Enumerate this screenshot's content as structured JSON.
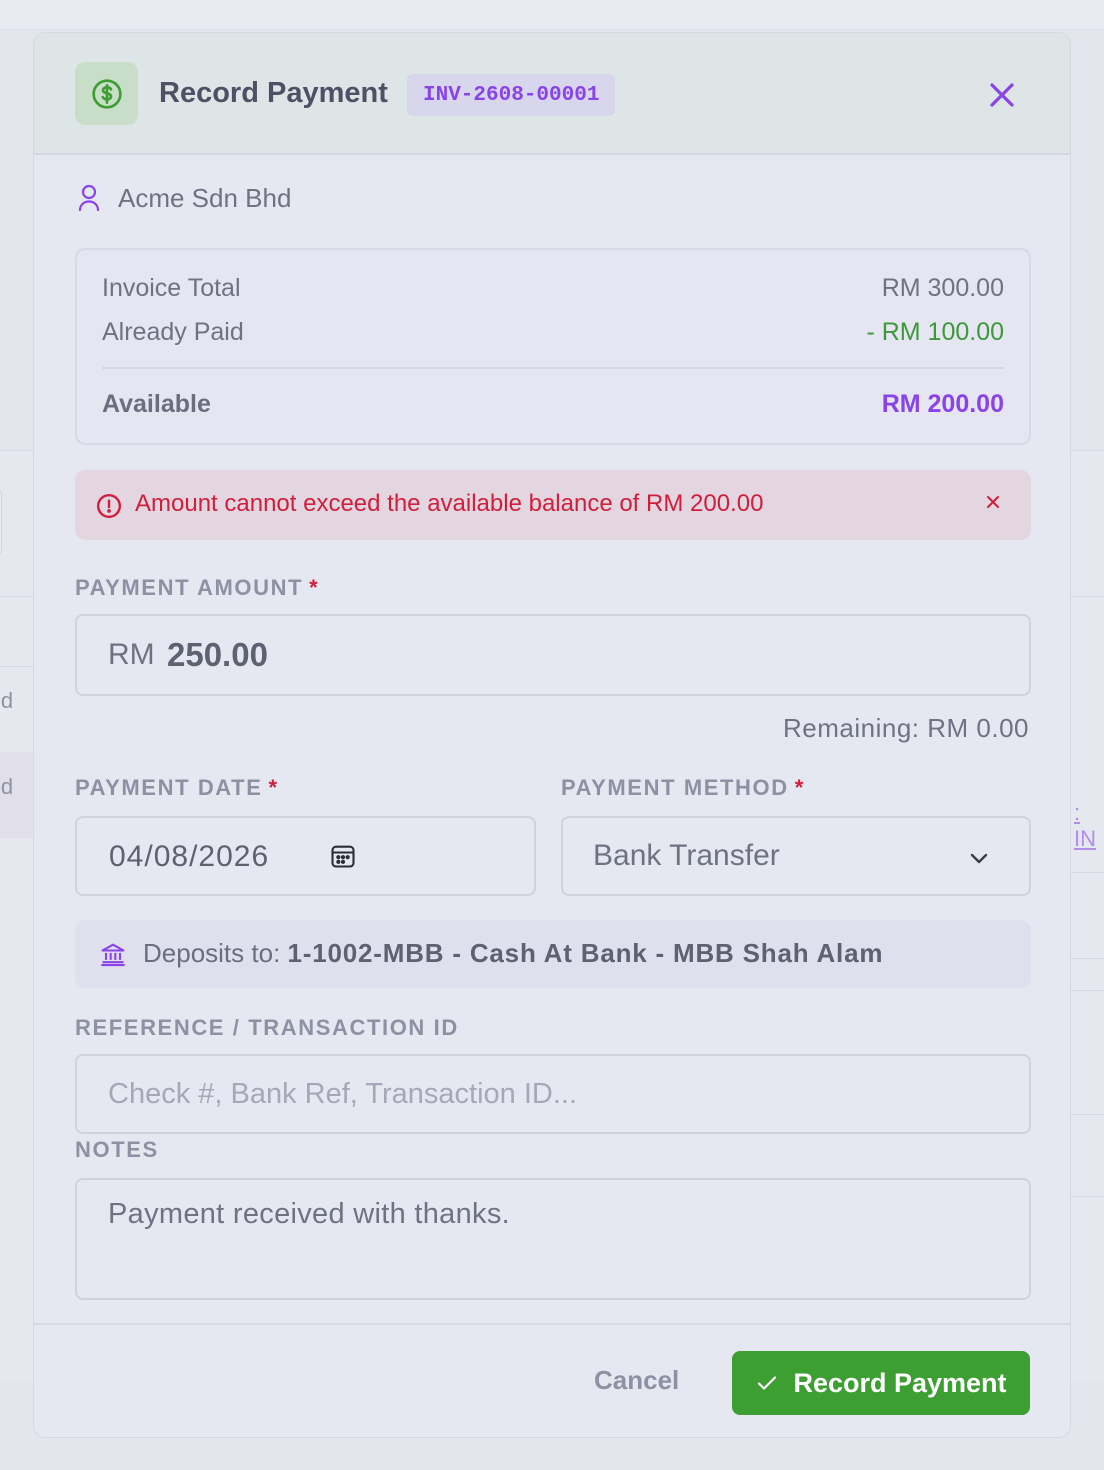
{
  "modal": {
    "title": "Record Payment",
    "invoice_number": "INV-2608-00001"
  },
  "customer": {
    "name": "Acme Sdn Bhd"
  },
  "summary": {
    "invoice_total_label": "Invoice Total",
    "invoice_total_value": "RM 300.00",
    "already_paid_label": "Already Paid",
    "already_paid_value": "- RM 100.00",
    "available_label": "Available",
    "available_value": "RM 200.00"
  },
  "alert": {
    "message": "Amount cannot exceed the available balance of RM 200.00"
  },
  "payment_amount": {
    "label": "PAYMENT AMOUNT",
    "required_mark": "*",
    "currency": "RM",
    "value": "250.00",
    "remaining": "Remaining: RM 0.00"
  },
  "payment_date": {
    "label": "PAYMENT DATE",
    "required_mark": "*",
    "value": "04/08/2026"
  },
  "payment_method": {
    "label": "PAYMENT METHOD",
    "required_mark": "*",
    "selected": "Bank Transfer"
  },
  "deposit": {
    "label": "Deposits to: ",
    "account": "1-1002-MBB - Cash At Bank - MBB Shah Alam"
  },
  "reference": {
    "label": "REFERENCE / TRANSACTION ID",
    "placeholder": "Check #, Bank Ref, Transaction ID..."
  },
  "notes": {
    "label": "NOTES",
    "value": "Payment received with thanks."
  },
  "footer": {
    "cancel_label": "Cancel",
    "submit_label": "Record Payment"
  },
  "background": {
    "left_fragment_1": "id",
    "left_fragment_2": "id",
    "right_fragment": ": IN"
  },
  "icons": {
    "header": "dollar-circle-icon",
    "close": "close-icon",
    "customer": "user-icon",
    "alert": "alert-circle-icon",
    "alert_close": "close-icon",
    "calendar": "calendar-icon",
    "select": "chevron-down-icon",
    "deposit": "bank-icon",
    "submit": "check-icon"
  },
  "colors": {
    "accent": "#8a43e8",
    "success": "#3d9e32",
    "error": "#d01e3c"
  }
}
